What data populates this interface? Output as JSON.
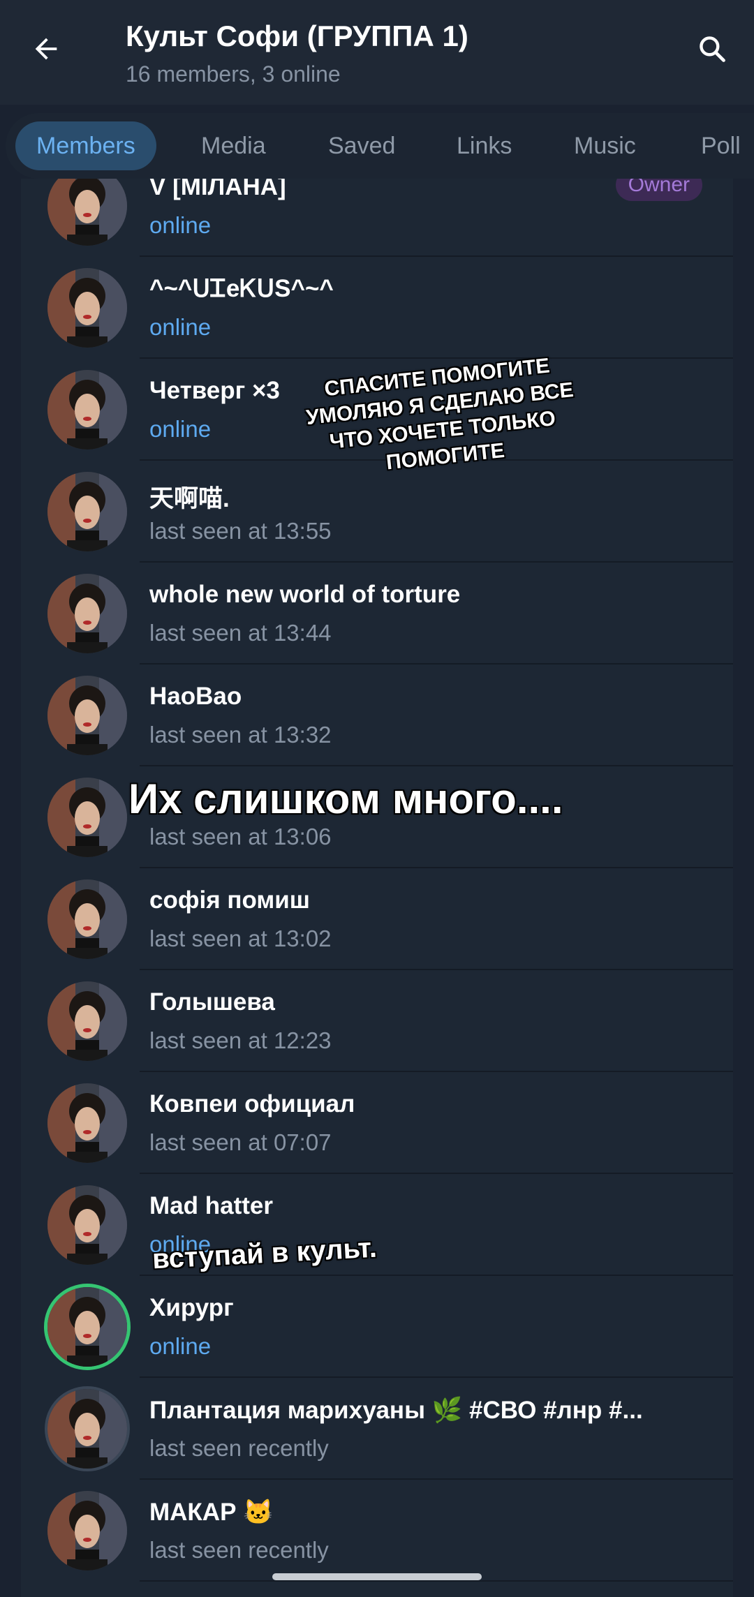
{
  "header": {
    "title": "Культ Софи (ГРУППА 1)",
    "subtitle": "16 members, 3 online",
    "back_icon": "arrow-left-icon",
    "search_icon": "search-icon"
  },
  "tabs": [
    "Members",
    "Media",
    "Saved",
    "Links",
    "Music",
    "Poll"
  ],
  "active_tab": "Members",
  "members": [
    {
      "name": "V [MIЛAHA]",
      "status": "online",
      "badge": "Owner"
    },
    {
      "name": "^~^ᑌᏆeᏦᑌS^~^",
      "status": "online"
    },
    {
      "name": "Четверг ×3",
      "status": "online"
    },
    {
      "name": "天啊喵.",
      "status": "last seen at 13:55"
    },
    {
      "name": "whole new world of torture",
      "status": "last seen at 13:44"
    },
    {
      "name": "HaoBao",
      "status": "last seen at 13:32"
    },
    {
      "name": "",
      "status": "last seen at 13:06"
    },
    {
      "name": "софія помиш",
      "status": "last seen at 13:02"
    },
    {
      "name": "Голышева",
      "status": "last seen at 12:23"
    },
    {
      "name": "Ковпеи официал",
      "status": "last seen at 07:07"
    },
    {
      "name": "Mad hatter",
      "status": "online"
    },
    {
      "name": "Хирург",
      "status": "online"
    },
    {
      "name": "Плантация марихуаны 🌿 #СВО #лнр #...",
      "status": "last seen recently"
    },
    {
      "name": "МАКАР 🐱",
      "status": "last seen recently"
    }
  ],
  "captions": {
    "plea": "СПАСИТЕ ПОМОГИТЕ УМОЛЯЮ Я СДЕЛАЮ ВСЕ ЧТО ХОЧЕТЕ ТОЛЬКО ПОМОГИТЕ",
    "many": "Их слишком много....",
    "join": "вступай в культ."
  },
  "colors": {
    "background": "#1a2230",
    "accent": "#5eaaf0",
    "online": "#5eaaf0",
    "muted": "#8793a3",
    "owner_badge": "#a47ad8"
  }
}
